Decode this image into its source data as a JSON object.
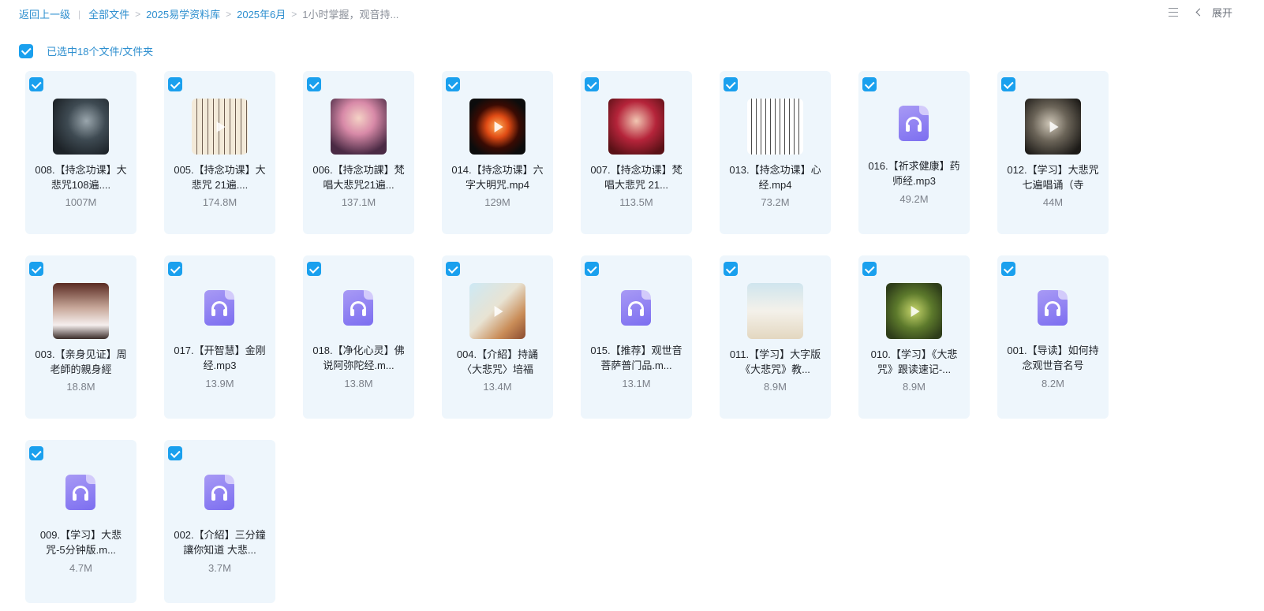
{
  "breadcrumb": {
    "back": "返回上一级",
    "items": [
      "全部文件",
      "2025易学资料库",
      "2025年6月"
    ],
    "current": "1小时掌握，观音持..."
  },
  "toolbar": {
    "expand_label": "展开",
    "list_icon": "list-view-icon",
    "chevron_icon": "chevron-left-icon"
  },
  "selection": {
    "label": "已选中18个文件/文件夹"
  },
  "colors": {
    "accent": "#1aa0ee",
    "link": "#2e8fcf",
    "card_bg": "#eef6fc",
    "audio_icon": "#8b7df2"
  },
  "files": [
    {
      "name": "008.【持念功课】大悲咒108遍....",
      "size": "1007M",
      "type": "video"
    },
    {
      "name": "005.【持念功课】大悲咒 21遍....",
      "size": "174.8M",
      "type": "video"
    },
    {
      "name": "006.【持念功課】梵唱大悲咒21遍...",
      "size": "137.1M",
      "type": "video"
    },
    {
      "name": "014.【持念功课】六字大明咒.mp4",
      "size": "129M",
      "type": "video"
    },
    {
      "name": "007.【持念功课】梵唱大悲咒 21...",
      "size": "113.5M",
      "type": "video"
    },
    {
      "name": "013.【持念功课】心经.mp4",
      "size": "73.2M",
      "type": "video"
    },
    {
      "name": "016.【祈求健康】药师经.mp3",
      "size": "49.2M",
      "type": "audio"
    },
    {
      "name": "012.【学习】大悲咒七遍唱诵（寺",
      "size": "44M",
      "type": "video"
    },
    {
      "name": "003.【亲身见证】周老師的親身經",
      "size": "18.8M",
      "type": "video"
    },
    {
      "name": "017.【开智慧】金刚经.mp3",
      "size": "13.9M",
      "type": "audio"
    },
    {
      "name": "018.【净化心灵】佛说阿弥陀经.m...",
      "size": "13.8M",
      "type": "audio"
    },
    {
      "name": "004.【介紹】持誦〈大悲咒〉培福",
      "size": "13.4M",
      "type": "video"
    },
    {
      "name": "015.【推荐】观世音菩萨普门品.m...",
      "size": "13.1M",
      "type": "audio"
    },
    {
      "name": "011.【学习】大字版《大悲咒》教...",
      "size": "8.9M",
      "type": "video"
    },
    {
      "name": "010.【学习】《大悲咒》跟读速记-...",
      "size": "8.9M",
      "type": "video"
    },
    {
      "name": "001.【导读】如何持念观世音名号",
      "size": "8.2M",
      "type": "audio"
    },
    {
      "name": "009.【学习】大悲咒-5分钟版.m...",
      "size": "4.7M",
      "type": "audio"
    },
    {
      "name": "002.【介紹】三分鐘讓你知道 大悲...",
      "size": "3.7M",
      "type": "audio"
    }
  ]
}
